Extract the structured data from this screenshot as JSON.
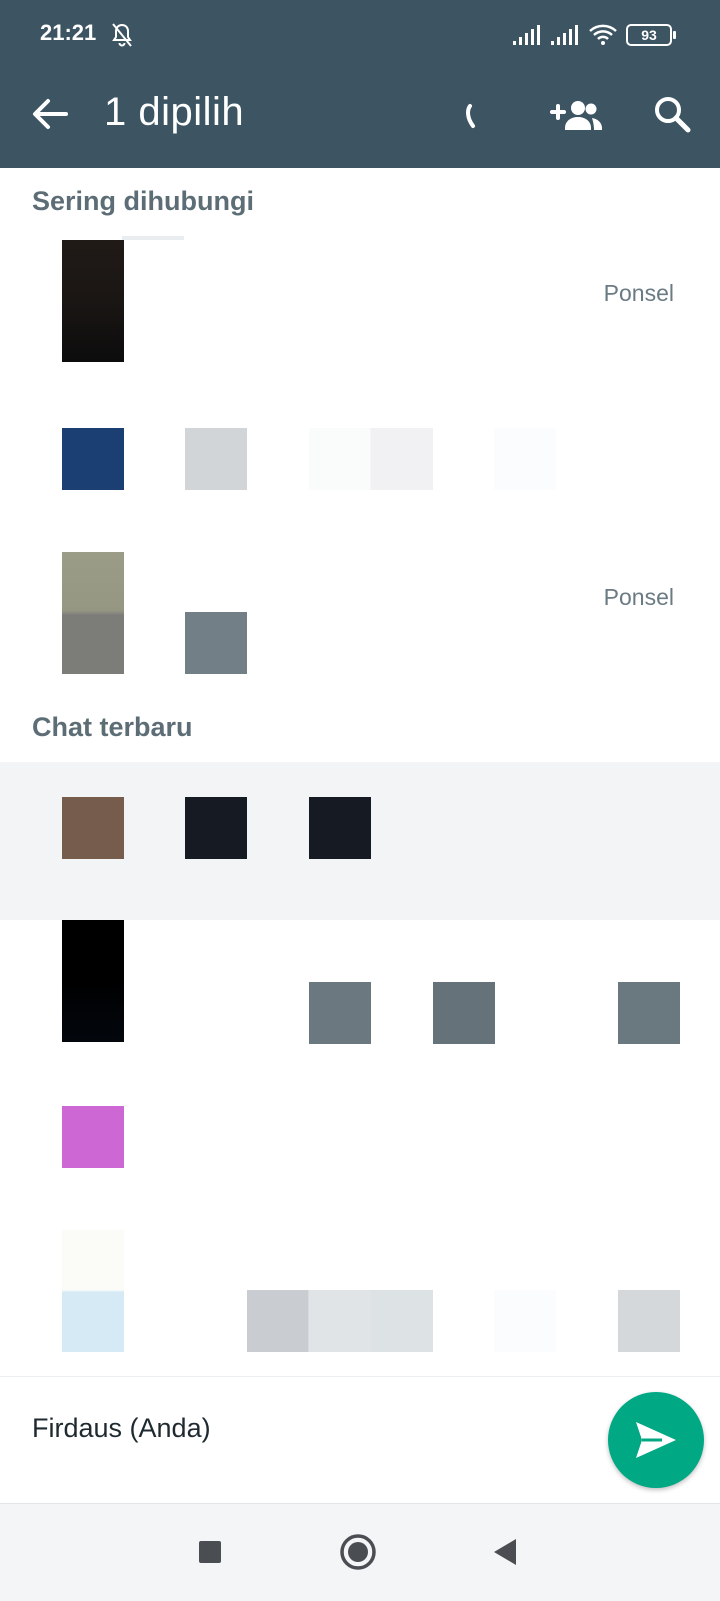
{
  "status_bar": {
    "time": "21:21",
    "battery_level": "93",
    "icons": [
      "bell-off-icon",
      "signal-icon",
      "signal-icon",
      "wifi-icon",
      "battery-icon"
    ]
  },
  "app_bar": {
    "title": "1 dipilih",
    "icons": [
      "back-arrow-icon",
      "call-icon",
      "add-group-icon",
      "search-icon"
    ],
    "background_color": "#3d5563"
  },
  "sections": {
    "frequent": {
      "title": "Sering dihubungi"
    },
    "recent": {
      "title": "Chat terbaru"
    }
  },
  "frequent_contacts": [
    {
      "meta": "Ponsel"
    },
    {
      "meta": ""
    },
    {
      "meta": "Ponsel"
    }
  ],
  "recent_chats": [
    {
      "selected": true
    },
    {
      "selected": false
    },
    {
      "selected": false
    },
    {
      "selected": false
    }
  ],
  "bottom_bar": {
    "selected_names": "Firdaus (Anda)",
    "send_icon": "send-icon",
    "accent_color": "#00a884"
  },
  "nav_bar": {
    "icons": [
      "recent-apps-icon",
      "home-icon",
      "back-icon"
    ]
  }
}
